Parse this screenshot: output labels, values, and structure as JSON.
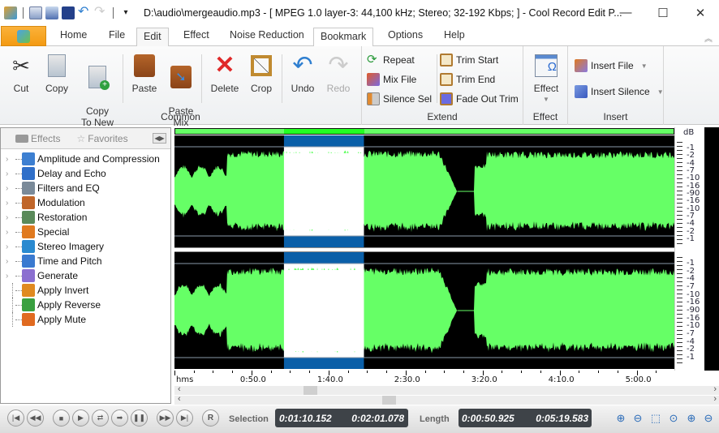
{
  "window": {
    "title": "D:\\audio\\mergeaudio.mp3 - [ MPEG 1.0 layer-3: 44,100 kHz; Stereo; 32-192 Kbps;  ] - Cool Record Edit P...",
    "minimize": "—",
    "maximize": "☐",
    "close": "✕"
  },
  "quick_access": [
    "app-icon",
    "new-icon",
    "open-icon",
    "save-icon",
    "undo-icon",
    "redo-icon",
    "customize-icon"
  ],
  "tabs": [
    {
      "label": "Home"
    },
    {
      "label": "File"
    },
    {
      "label": "Edit",
      "active": true
    },
    {
      "label": "Effect"
    },
    {
      "label": "Noise Reduction"
    },
    {
      "label": "Bookmark"
    },
    {
      "label": "Options"
    },
    {
      "label": "Help"
    }
  ],
  "ribbon": {
    "common": {
      "label": "Common",
      "buttons": [
        {
          "label": "Cut",
          "icon": "scissors-icon"
        },
        {
          "label": "Copy",
          "icon": "copy-icon"
        },
        {
          "label": "Copy\nTo New",
          "icon": "copy-to-new-icon"
        },
        {
          "label": "Paste",
          "icon": "paste-icon"
        },
        {
          "label": "Paste\nMix",
          "icon": "paste-mix-icon"
        },
        {
          "label": "Delete",
          "icon": "delete-icon"
        },
        {
          "label": "Crop",
          "icon": "crop-icon"
        },
        {
          "label": "Undo",
          "icon": "undo-icon"
        },
        {
          "label": "Redo",
          "icon": "redo-icon",
          "disabled": true
        }
      ]
    },
    "extend": {
      "label": "Extend",
      "buttons": [
        {
          "label": "Repeat",
          "icon": "repeat-icon"
        },
        {
          "label": "Mix File",
          "icon": "mix-file-icon"
        },
        {
          "label": "Silence Sel",
          "icon": "silence-sel-icon"
        },
        {
          "label": "Trim Start",
          "icon": "trim-start-icon"
        },
        {
          "label": "Trim End",
          "icon": "trim-end-icon"
        },
        {
          "label": "Fade Out Trim",
          "icon": "fade-out-trim-icon"
        }
      ]
    },
    "effect": {
      "label": "Effect",
      "button": "Effect"
    },
    "insert": {
      "label": "Insert",
      "buttons": [
        {
          "label": "Insert File",
          "icon": "insert-file-icon"
        },
        {
          "label": "Insert Silence",
          "icon": "insert-silence-icon"
        }
      ]
    }
  },
  "left_panel": {
    "tabs": [
      {
        "label": "Effects"
      },
      {
        "label": "Favorites"
      }
    ],
    "items": [
      {
        "label": "Amplitude and Compression",
        "expandable": true,
        "color": "#3d7fd1"
      },
      {
        "label": "Delay and Echo",
        "expandable": true,
        "color": "#2f6fc9"
      },
      {
        "label": "Filters and EQ",
        "expandable": true,
        "color": "#7a8a99"
      },
      {
        "label": "Modulation",
        "expandable": true,
        "color": "#c0662a"
      },
      {
        "label": "Restoration",
        "expandable": true,
        "color": "#5a8a5a"
      },
      {
        "label": "Special",
        "expandable": true,
        "color": "#e07a20"
      },
      {
        "label": "Stereo Imagery",
        "expandable": true,
        "color": "#2a8ad0"
      },
      {
        "label": "Time and Pitch",
        "expandable": true,
        "color": "#3a7ad0"
      },
      {
        "label": "Generate",
        "expandable": true,
        "color": "#8b6fd0"
      },
      {
        "label": "Apply Invert",
        "expandable": false,
        "color": "#e08a20"
      },
      {
        "label": "Apply Reverse",
        "expandable": false,
        "color": "#3aa040"
      },
      {
        "label": "Apply Mute",
        "expandable": false,
        "color": "#e06a20"
      }
    ]
  },
  "waveform": {
    "colors": {
      "wave": "#66ff66",
      "background": "#000000",
      "selection_bg": "#ffffff",
      "selection_wave": "#0a5fa8",
      "overview_sel": "#22ff22"
    },
    "selection_fraction": [
      0.219,
      0.379
    ],
    "db_label": "dB",
    "db_scale": [
      "-1",
      "-2",
      "-4",
      "-7",
      "-10",
      "-16",
      "-90",
      "-16",
      "-10",
      "-7",
      "-4",
      "-2",
      "-1"
    ]
  },
  "timeline": {
    "unit": "hms",
    "labels": [
      "0:50.0",
      "1:40.0",
      "2:30.0",
      "3:20.0",
      "4:10.0",
      "5:00.0"
    ],
    "total_seconds": 319.583
  },
  "scrollbars": {
    "h1_thumb": 0.237,
    "h2_thumb": 0.381
  },
  "transport": {
    "buttons": [
      "skip-start",
      "rewind",
      "stop",
      "play",
      "loop",
      "play-selection",
      "pause",
      "fast-forward",
      "skip-end",
      "record"
    ],
    "record_label": "R",
    "selection_label": "Selection",
    "selection_start": "0:01:10.152",
    "selection_end": "0:02:01.078",
    "length_label": "Length",
    "selection_length": "0:00:50.925",
    "total_length": "0:05:19.583"
  },
  "zoom_buttons": [
    "zoom-in-icon",
    "zoom-out-icon",
    "zoom-selection-icon",
    "zoom-all-icon",
    "zoom-in-vertical-icon",
    "zoom-out-vertical-icon"
  ]
}
